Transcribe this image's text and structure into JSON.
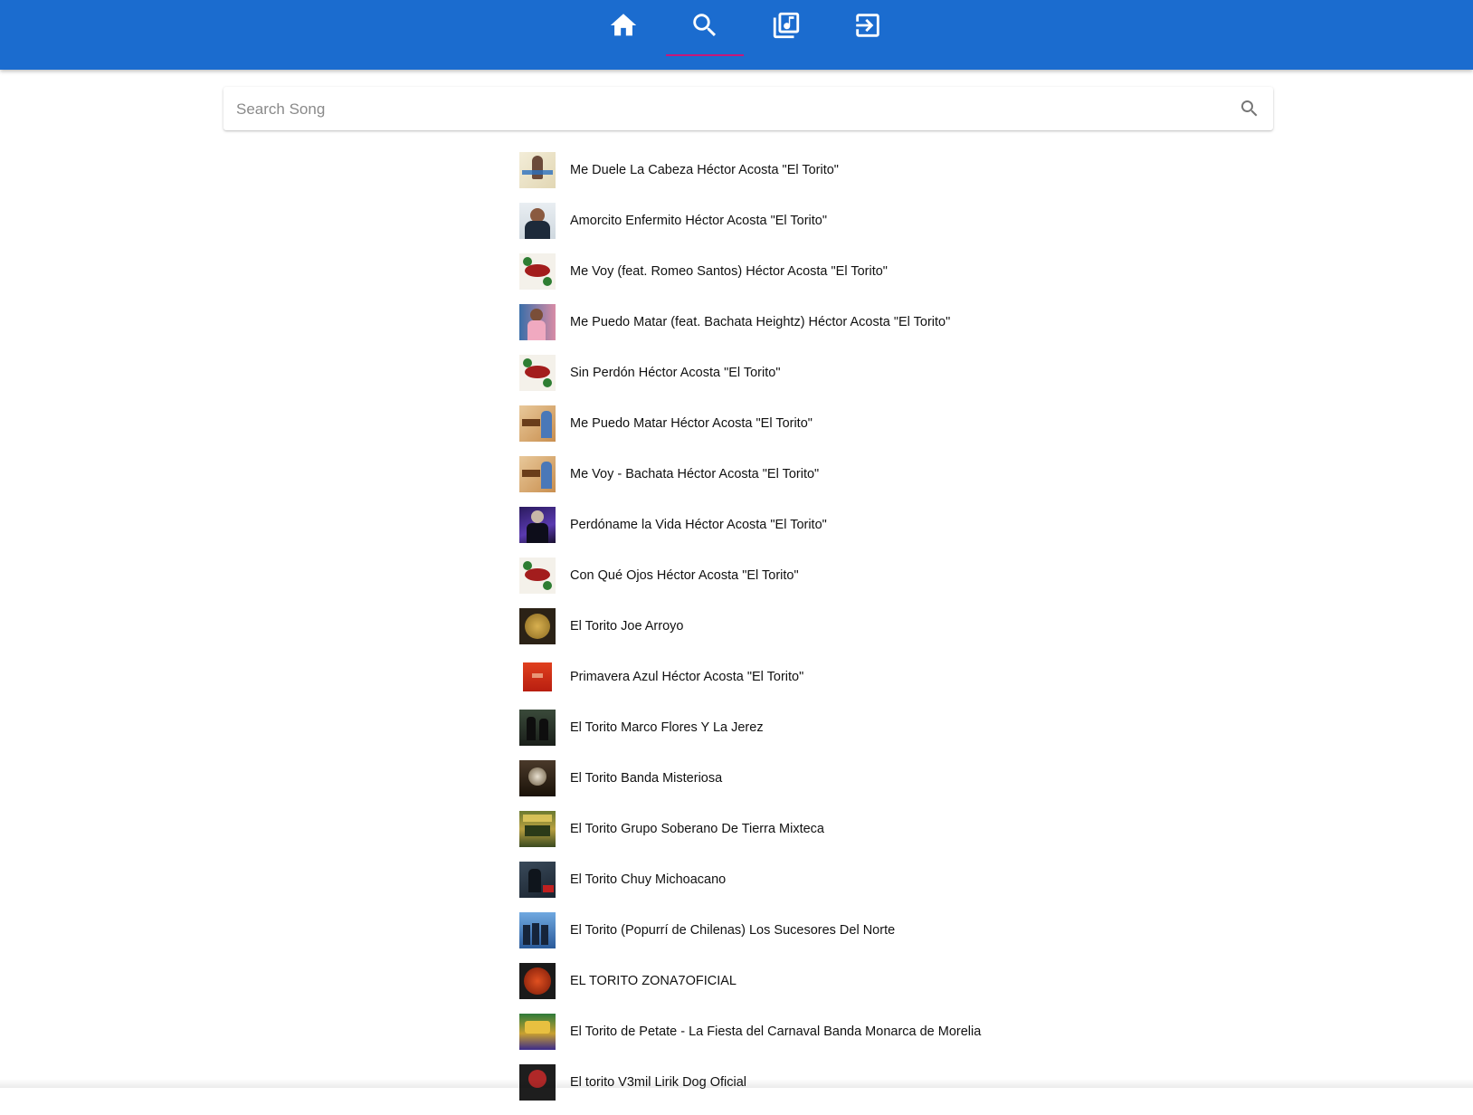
{
  "nav": {
    "tabs": [
      {
        "icon": "home-icon"
      },
      {
        "icon": "search-icon",
        "active": true
      },
      {
        "icon": "library-music-icon"
      },
      {
        "icon": "logout-icon"
      }
    ],
    "accent_color": "#1b6ccf",
    "active_indicator_color": "#c8177a"
  },
  "search": {
    "placeholder": "Search Song",
    "value": "",
    "button_icon": "search-icon"
  },
  "songs": [
    {
      "title": "Me Duele La Cabeza Héctor Acosta \"El Torito\""
    },
    {
      "title": "Amorcito Enfermito Héctor Acosta \"El Torito\""
    },
    {
      "title": "Me Voy (feat. Romeo Santos) Héctor Acosta \"El Torito\""
    },
    {
      "title": "Me Puedo Matar (feat. Bachata Heightz) Héctor Acosta \"El Torito\""
    },
    {
      "title": "Sin Perdón Héctor Acosta \"El Torito\""
    },
    {
      "title": "Me Puedo Matar Héctor Acosta \"El Torito\""
    },
    {
      "title": "Me Voy - Bachata Héctor Acosta \"El Torito\""
    },
    {
      "title": "Perdóname la Vida Héctor Acosta \"El Torito\""
    },
    {
      "title": "Con Qué Ojos Héctor Acosta \"El Torito\""
    },
    {
      "title": "El Torito Joe Arroyo"
    },
    {
      "title": "Primavera Azul Héctor Acosta \"El Torito\""
    },
    {
      "title": "El Torito Marco Flores Y La Jerez"
    },
    {
      "title": "El Torito Banda Misteriosa"
    },
    {
      "title": "El Torito Grupo Soberano De Tierra Mixteca"
    },
    {
      "title": "El Torito Chuy Michoacano"
    },
    {
      "title": "El Torito (Popurrí de Chilenas) Los Sucesores Del Norte"
    },
    {
      "title": "EL TORITO ZONA7OFICIAL"
    },
    {
      "title": "El Torito de Petate - La Fiesta del Carnaval Banda Monarca de Morelia"
    },
    {
      "title": "El torito V3mil Lirik Dog Oficial"
    }
  ]
}
